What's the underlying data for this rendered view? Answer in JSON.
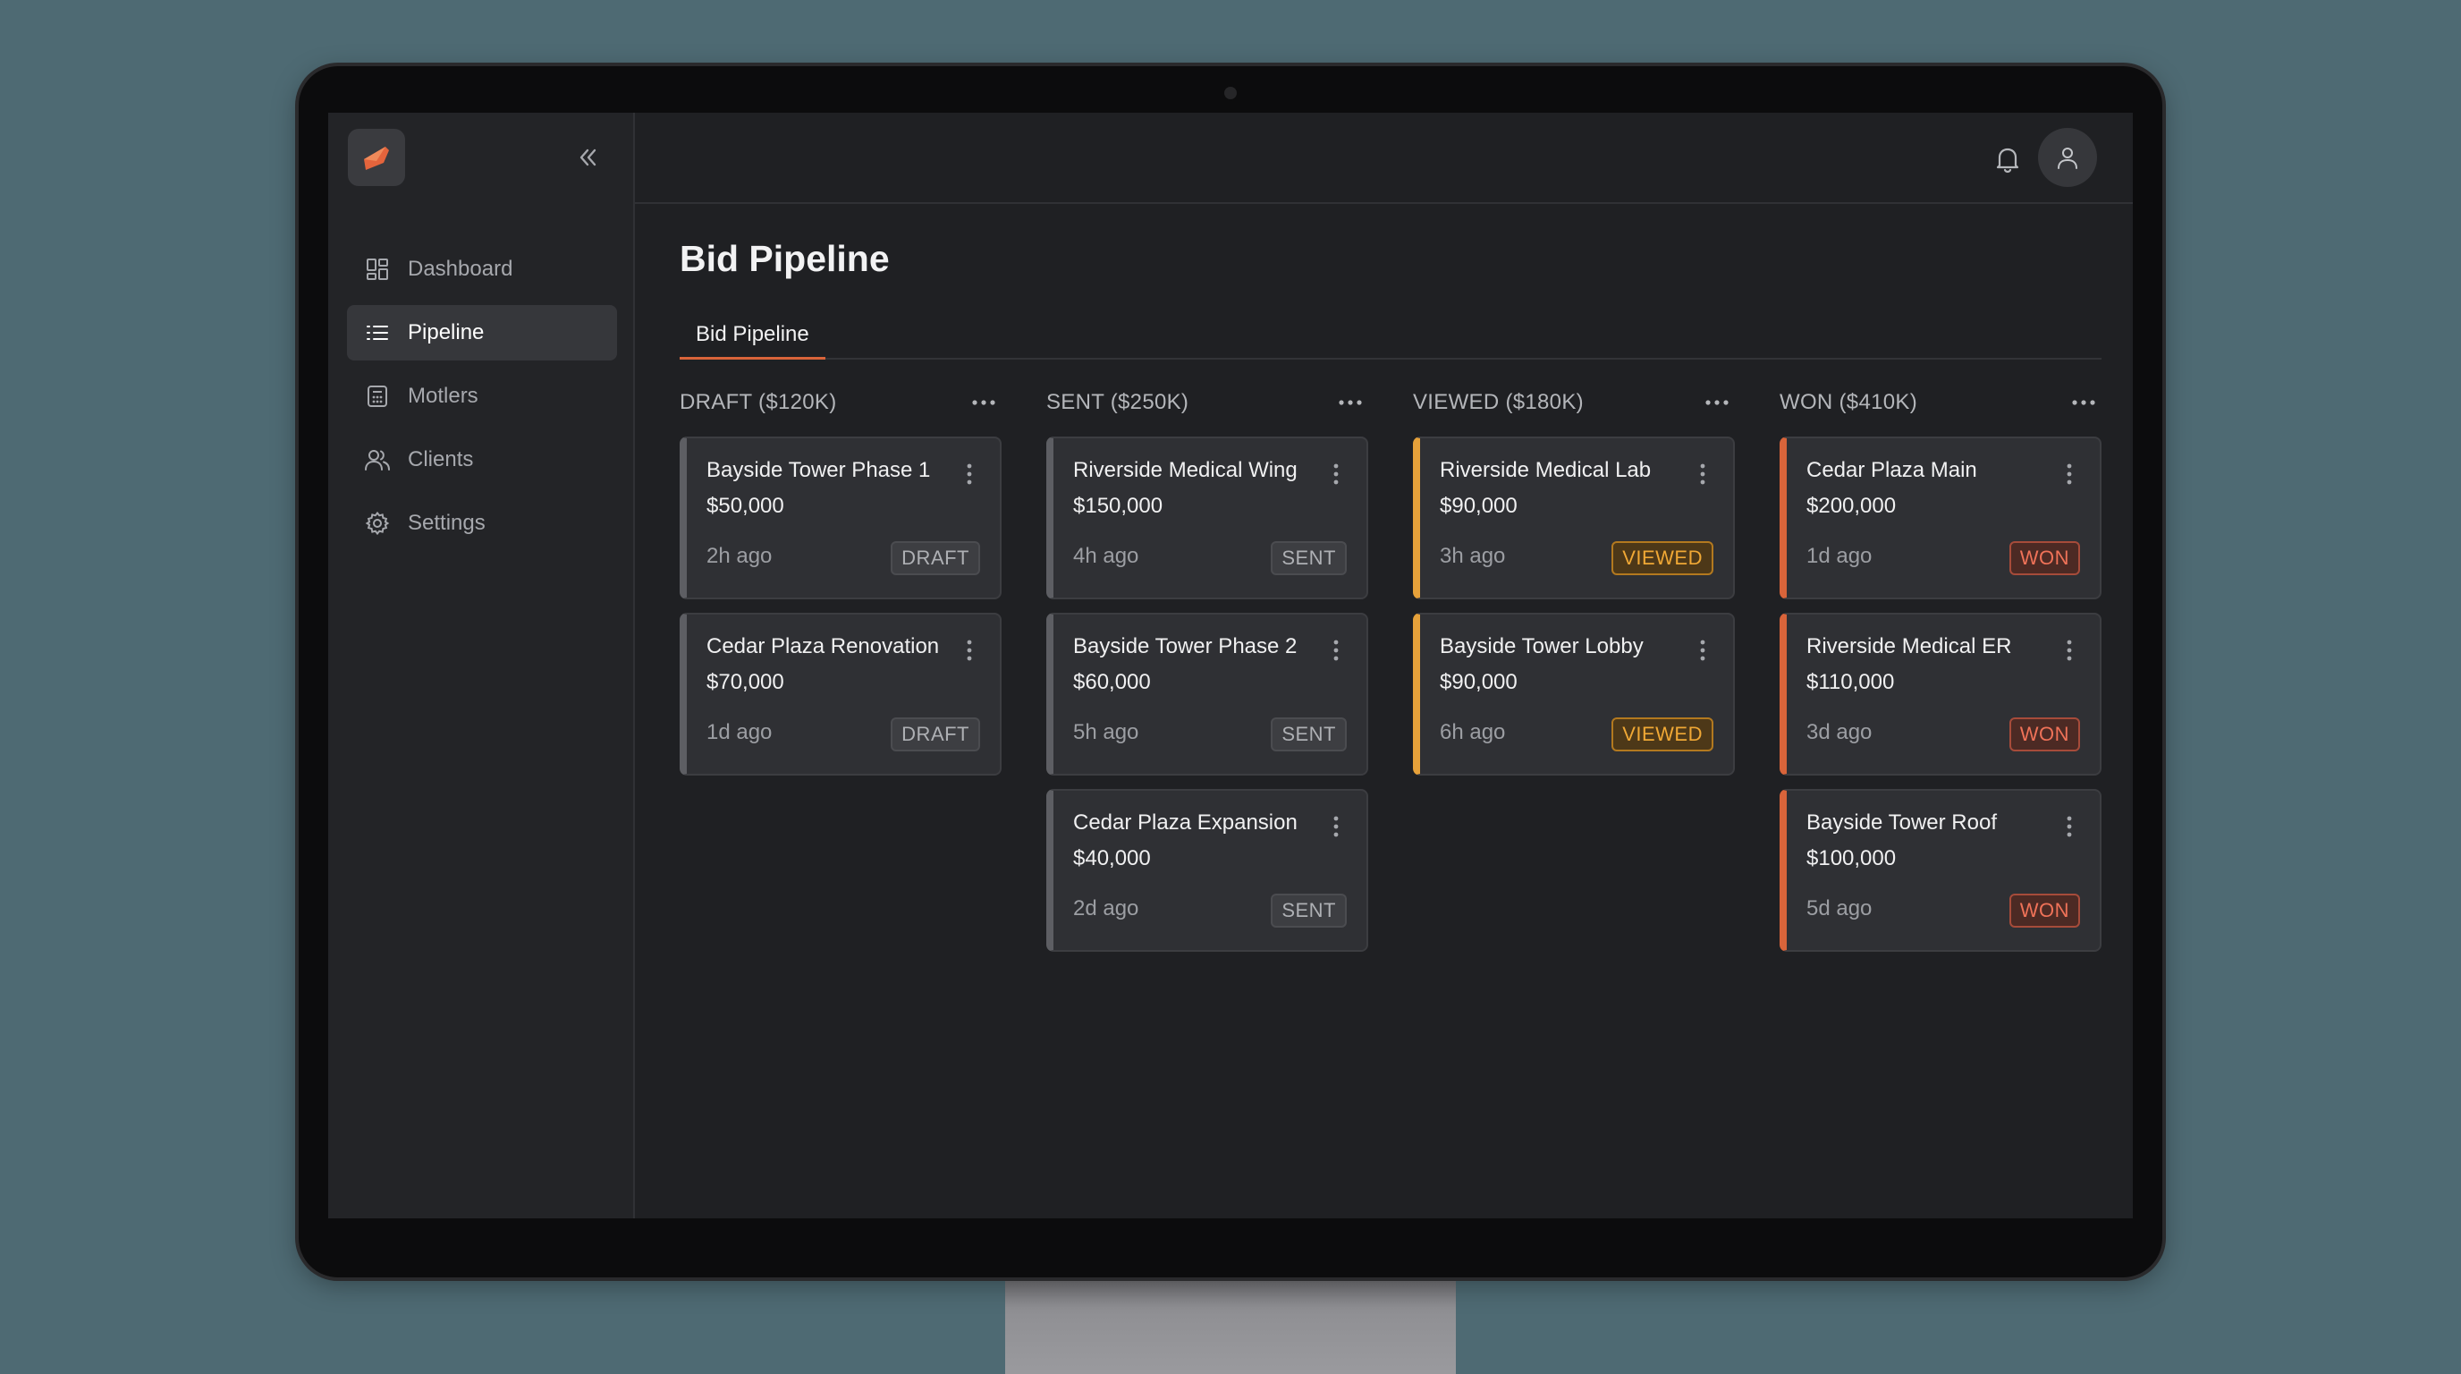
{
  "app": {
    "page_title": "Bid Pipeline",
    "accent_color": "#d9643a"
  },
  "sidebar": {
    "items": [
      {
        "label": "Dashboard",
        "icon": "grid-icon",
        "active": false
      },
      {
        "label": "Pipeline",
        "icon": "list-icon",
        "active": true
      },
      {
        "label": "Motlers",
        "icon": "calculator-icon",
        "active": false
      },
      {
        "label": "Clients",
        "icon": "users-icon",
        "active": false
      },
      {
        "label": "Settings",
        "icon": "gear-icon",
        "active": false
      }
    ]
  },
  "tabs": [
    {
      "label": "Bid Pipeline",
      "active": true
    }
  ],
  "columns": [
    {
      "title": "DRAFT ($120K)",
      "status": "draft",
      "cards": [
        {
          "name": "Bayside Tower Phase 1",
          "amount": "$50,000",
          "time": "2h ago",
          "badge": "DRAFT"
        },
        {
          "name": "Cedar Plaza Renovation",
          "amount": "$70,000",
          "time": "1d ago",
          "badge": "DRAFT"
        }
      ]
    },
    {
      "title": "SENT ($250K)",
      "status": "sent",
      "cards": [
        {
          "name": "Riverside Medical Wing",
          "amount": "$150,000",
          "time": "4h ago",
          "badge": "SENT"
        },
        {
          "name": "Bayside Tower Phase 2",
          "amount": "$60,000",
          "time": "5h ago",
          "badge": "SENT"
        },
        {
          "name": "Cedar Plaza Expansion",
          "amount": "$40,000",
          "time": "2d ago",
          "badge": "SENT"
        }
      ]
    },
    {
      "title": "VIEWED ($180K)",
      "status": "viewed",
      "cards": [
        {
          "name": "Riverside Medical Lab",
          "amount": "$90,000",
          "time": "3h ago",
          "badge": "VIEWED"
        },
        {
          "name": "Bayside Tower Lobby",
          "amount": "$90,000",
          "time": "6h ago",
          "badge": "VIEWED"
        }
      ]
    },
    {
      "title": "WON ($410K)",
      "status": "won",
      "cards": [
        {
          "name": "Cedar Plaza Main",
          "amount": "$200,000",
          "time": "1d ago",
          "badge": "WON"
        },
        {
          "name": "Riverside Medical ER",
          "amount": "$110,000",
          "time": "3d ago",
          "badge": "WON"
        },
        {
          "name": "Bayside Tower Roof",
          "amount": "$100,000",
          "time": "5d ago",
          "badge": "WON"
        }
      ]
    }
  ]
}
